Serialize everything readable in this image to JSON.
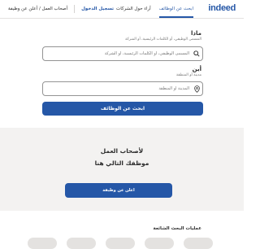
{
  "header": {
    "logo": "indeed",
    "tabs": [
      {
        "label": "ابحث عن الوظائف",
        "active": true
      },
      {
        "label": "آراء حول الشركات",
        "active": false
      }
    ],
    "signin": "تسجيل الدخول",
    "employers": "أصحاب العمل / أعلن عن وظيفة"
  },
  "search": {
    "what_label": "ماذا",
    "what_hint": "المسمى الوظيفي، أو الكلمات الرئيسية، أو الشركة",
    "what_placeholder": "المسمى الوظيفي، أو الكلمات الرئيسية، أو الشركة",
    "where_label": "أين",
    "where_hint": "مدينة أو المنطقة",
    "where_placeholder": "المدينة أو المنطقة",
    "submit": "ابحث عن الوظائف"
  },
  "employers_section": {
    "line1": "لأصحاب العمل",
    "line2": "موظفك التالي هنا",
    "button": "اعلن عن وظيفة"
  },
  "popular_searches": {
    "title": "عمليات البحث الشائعة"
  },
  "colors": {
    "brand": "#2557a7",
    "band": "#f3f2f1"
  }
}
